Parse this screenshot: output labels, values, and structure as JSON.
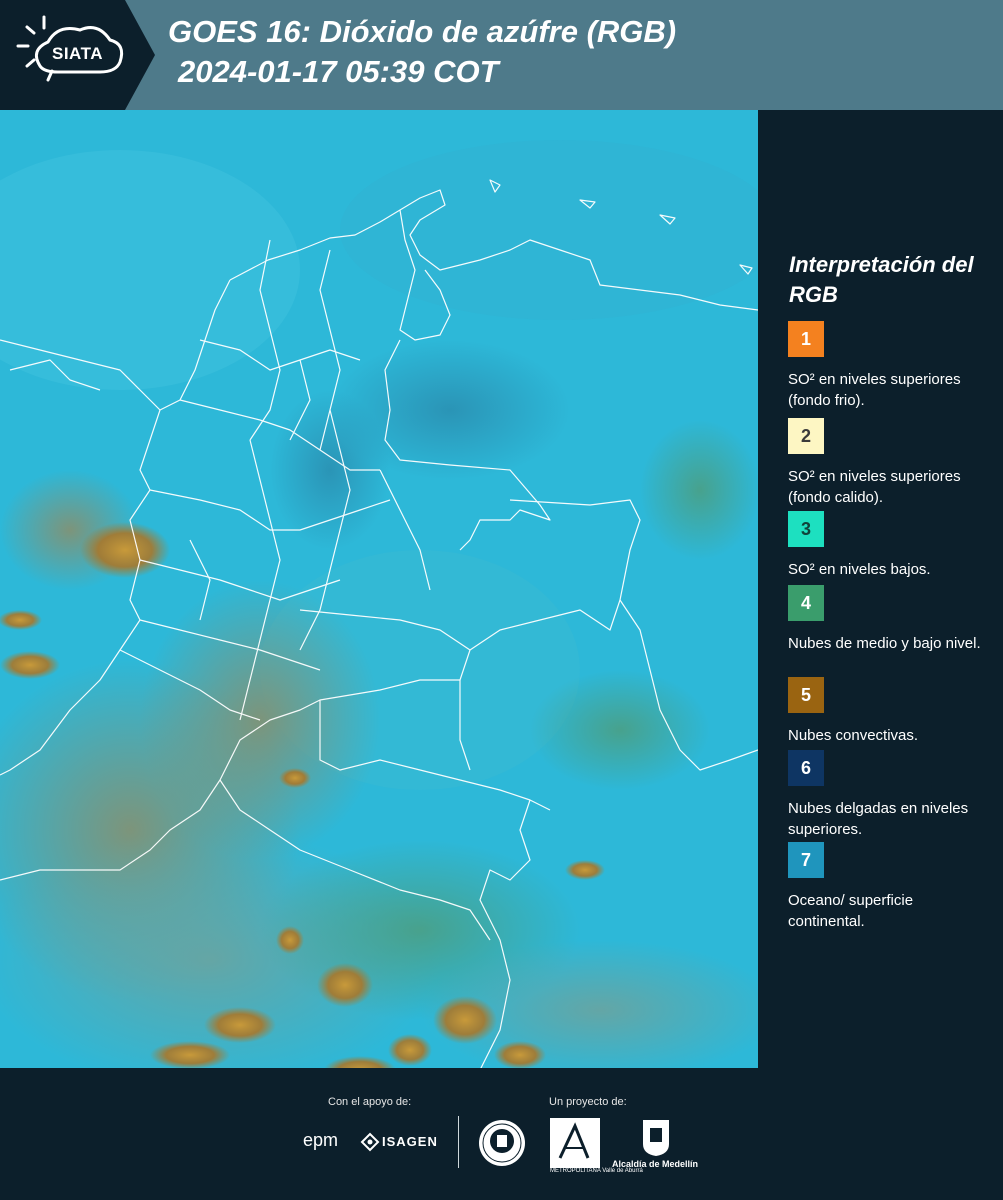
{
  "header": {
    "logo_text": "SIATA",
    "title": "GOES 16: Dióxido de azúfre (RGB)",
    "subtitle": "2024-01-17 05:39 COT"
  },
  "legend": {
    "title": "Interpretación del RGB",
    "items": [
      {
        "number": "1",
        "color": "#f4811f",
        "text_color": "#ffffff",
        "label": "SO² en niveles superiores (fondo frio)."
      },
      {
        "number": "2",
        "color": "#fdf6c3",
        "text_color": "#3a3a3a",
        "label": "SO² en niveles superiores (fondo calido)."
      },
      {
        "number": "3",
        "color": "#1de0c0",
        "text_color": "#10433a",
        "label": "SO² en niveles bajos."
      },
      {
        "number": "4",
        "color": "#3a9d6c",
        "text_color": "#ffffff",
        "label": "Nubes de medio y bajo nivel."
      },
      {
        "number": "5",
        "color": "#9a6411",
        "text_color": "#ffffff",
        "label": "Nubes convectivas."
      },
      {
        "number": "6",
        "color": "#0e3563",
        "text_color": "#ffffff",
        "label": "Nubes delgadas en niveles superiores."
      },
      {
        "number": "7",
        "color": "#1f95bd",
        "text_color": "#ffffff",
        "label": "Oceano/ superficie continental."
      }
    ]
  },
  "footer": {
    "support_label": "Con el apoyo de:",
    "project_label": "Un proyecto de:",
    "sponsor_epm": "epm",
    "sponsor_isagen": "ISAGEN",
    "area_name": "Área",
    "area_subtext": "METROPOLITANA Valle de Aburrá",
    "alcaldia": "Alcaldía de Medellín"
  },
  "map": {
    "base_color": "#2fb6d6",
    "land_colors": [
      "#3ca9c2",
      "#67a39c",
      "#8f9a6f"
    ],
    "convective_color": "#b07f2c",
    "border_color": "#ffffff"
  }
}
